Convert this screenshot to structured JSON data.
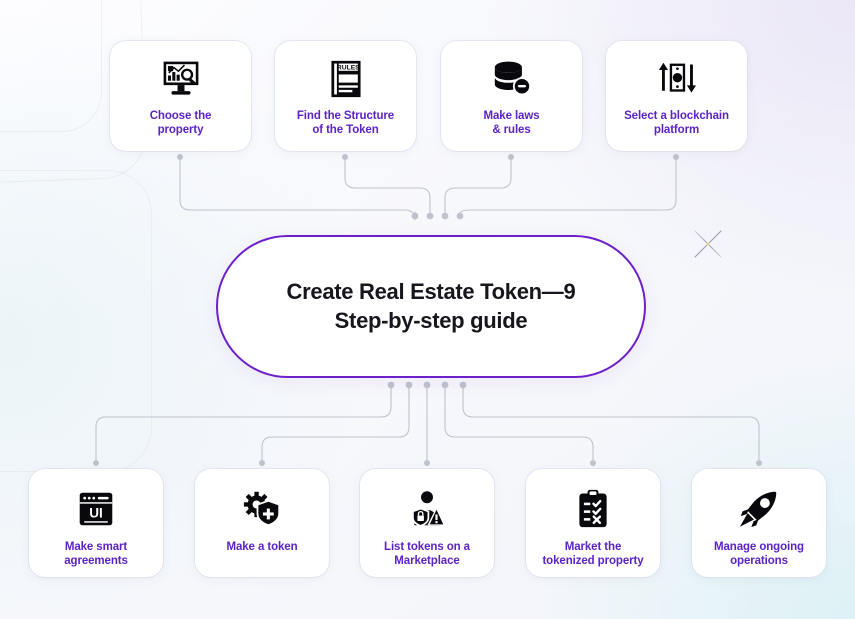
{
  "diagram": {
    "center": {
      "title": "Create Real Estate Token—9 Step-by-step guide",
      "line1": "Create Real Estate Token—9",
      "line2": "Step-by-step guide",
      "border_color": "#6d20c9",
      "text_color": "#16161d"
    },
    "label_color": "#5c23c4",
    "icon_color": "#09090d",
    "connector_color": "#b9bdc9",
    "top_steps": [
      {
        "id": 1,
        "line1": "Choose the",
        "line2": "property",
        "label": "Choose the property",
        "icon": "monitor-chart-search-icon"
      },
      {
        "id": 2,
        "line1": "Find the Structure",
        "line2": "of the Token",
        "label": "Find the Structure of the Token",
        "icon": "rules-book-icon"
      },
      {
        "id": 3,
        "line1": "Make laws",
        "line2": "& rules",
        "label": "Make laws & rules",
        "icon": "database-badge-icon"
      },
      {
        "id": 4,
        "line1": "Select a blockchain",
        "line2": "platform",
        "label": "Select a blockchain platform",
        "icon": "banknote-arrows-icon"
      }
    ],
    "bottom_steps": [
      {
        "id": 5,
        "line1": "Make smart",
        "line2": "agreements",
        "label": "Make smart agreements",
        "icon": "browser-ui-icon"
      },
      {
        "id": 6,
        "line1": "Make a token",
        "line2": "",
        "label": "Make a token",
        "icon": "gear-shield-plus-icon"
      },
      {
        "id": 7,
        "line1": "List tokens on a",
        "line2": "Marketplace",
        "label": "List tokens on a Marketplace",
        "icon": "person-shield-warning-icon"
      },
      {
        "id": 8,
        "line1": "Market the",
        "line2": "tokenized property",
        "label": "Market the tokenized property",
        "icon": "clipboard-checklist-icon"
      },
      {
        "id": 9,
        "line1": "Manage ongoing",
        "line2": "operations",
        "label": "Manage ongoing operations",
        "icon": "rocket-icon"
      }
    ],
    "decoration": {
      "sparkle": "sparkle-star-icon"
    }
  }
}
